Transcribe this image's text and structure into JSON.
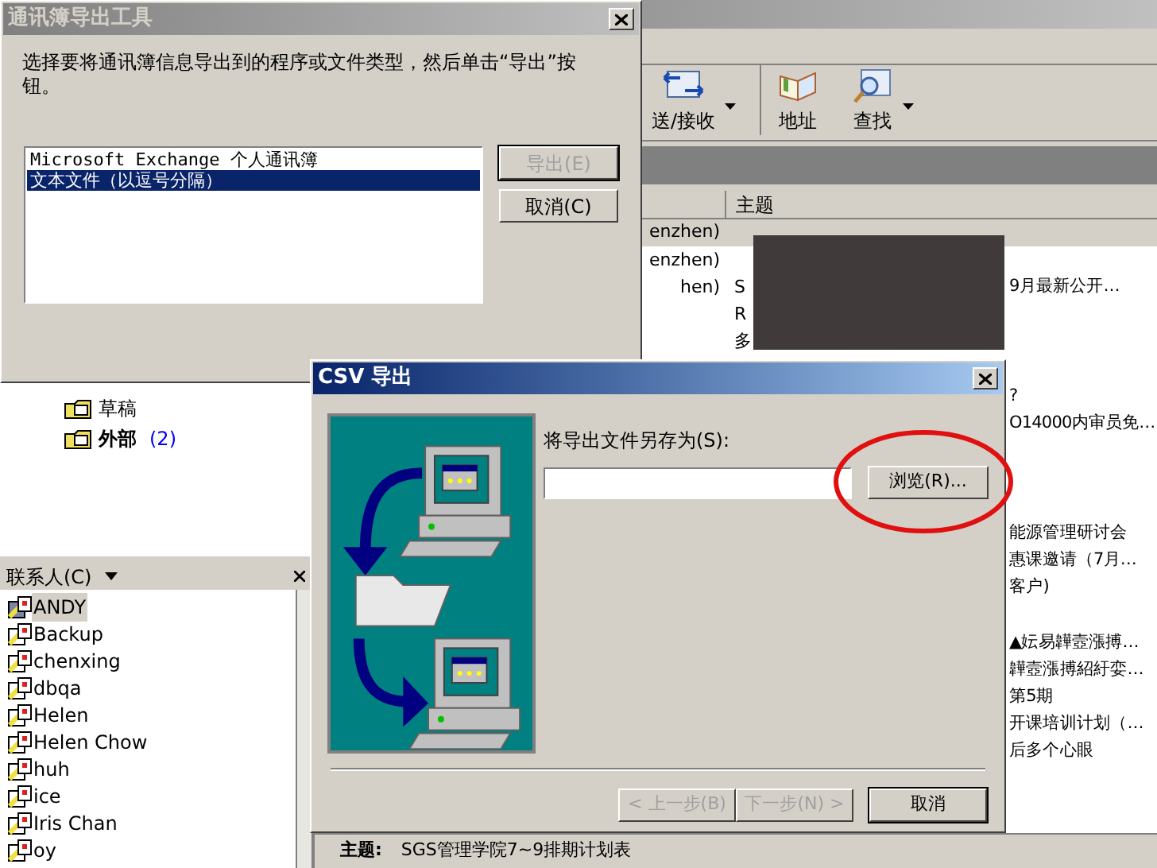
{
  "outlook": {
    "toolbar": [
      {
        "label": "送/接收",
        "has_menu": true,
        "kind": "sendrecv"
      },
      {
        "label": "地址",
        "has_menu": false,
        "kind": "book"
      },
      {
        "label": "查找",
        "has_menu": true,
        "kind": "find"
      }
    ],
    "message_list": {
      "columns": [
        "主题"
      ],
      "rows": [
        {
          "selected": true,
          "sender": "enzhen)"
        },
        {
          "selected": false,
          "sender": "enzhen)"
        },
        {
          "selected": false,
          "sender": "hen)",
          "subject": "S",
          "subject_right": "9月最新公开…"
        },
        {
          "selected": false,
          "subject": "R"
        },
        {
          "selected": false,
          "subject": "多"
        },
        {
          "selected": false
        },
        {
          "selected": false,
          "subject_right": "?"
        },
        {
          "selected": false,
          "subject_right": "O14000内审员免…"
        },
        {
          "selected": false
        },
        {
          "selected": false
        },
        {
          "selected": false
        },
        {
          "selected": false,
          "subject_right": "能源管理研讨会"
        },
        {
          "selected": false,
          "subject_right": "惠课邀请（7月…"
        },
        {
          "selected": false,
          "subject_right": "客户)"
        },
        {
          "selected": false
        },
        {
          "selected": false,
          "subject_right": "▲妘易韡壼漲搏…"
        },
        {
          "selected": false,
          "subject_right": "韡壼漲搏紹紆娈…"
        },
        {
          "selected": false,
          "subject_right": "第5期"
        },
        {
          "selected": false,
          "subject_right": "开课培训计划（…"
        },
        {
          "selected": false,
          "subject_right": "后多个心眼"
        }
      ]
    },
    "preview": {
      "label": "主题:",
      "value": "SGS管理学院7~9排期计划表"
    },
    "folders": [
      {
        "name": "草稿",
        "bold": false
      },
      {
        "name": "外部",
        "bold": true,
        "count": "(2)"
      }
    ],
    "contacts": {
      "title": "联系人(C)",
      "items": [
        {
          "name": "ANDY",
          "selected": true
        },
        {
          "name": "Backup",
          "selected": false
        },
        {
          "name": "chenxing",
          "selected": false
        },
        {
          "name": "dbqa",
          "selected": false
        },
        {
          "name": "Helen",
          "selected": false
        },
        {
          "name": "Helen Chow",
          "selected": false
        },
        {
          "name": "huh",
          "selected": false
        },
        {
          "name": "ice",
          "selected": false
        },
        {
          "name": "Iris Chan",
          "selected": false
        },
        {
          "name": "oy",
          "selected": false
        }
      ]
    }
  },
  "export_tool_dialog": {
    "title": "通讯簿导出工具",
    "active": false,
    "instruction": "选择要将通讯簿信息导出到的程序或文件类型，然后单击“导出”按钮。",
    "options": [
      {
        "label": "Microsoft Exchange 个人通讯簿",
        "selected": false
      },
      {
        "label": "文本文件（以逗号分隔）",
        "selected": true
      }
    ],
    "buttons": [
      {
        "label": "导出(E)",
        "disabled": true
      },
      {
        "label": "取消(C)",
        "disabled": false
      }
    ]
  },
  "csv_dialog": {
    "title": "CSV 导出",
    "active": true,
    "field_label": "将导出文件另存为(S):",
    "browse_button": "浏览(R)...",
    "buttons": [
      {
        "label": "< 上一步(B)",
        "disabled": true
      },
      {
        "label": "下一步(N) >",
        "disabled": true
      },
      {
        "label": "取消",
        "disabled": false
      }
    ]
  }
}
